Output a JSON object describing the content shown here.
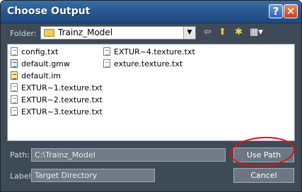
{
  "window": {
    "title": "Choose Output",
    "help_glyph": "?",
    "close_glyph": "✕"
  },
  "toolbar": {
    "folder_label": "Folder:",
    "folder_value": "Trainz_Model",
    "combo_arrow": "▼",
    "icons": {
      "back": "back-arrow-icon",
      "up": "up-folder-icon",
      "new_folder": "new-folder-icon",
      "views": "view-menu-icon"
    },
    "glyphs": {
      "back": "⇦",
      "up": "⬆",
      "new_folder": "✱",
      "views": "▦▾"
    }
  },
  "files": [
    {
      "name": "config.txt",
      "icon": "text-file-icon"
    },
    {
      "name": "default.gmw",
      "icon": "gmw-file-icon"
    },
    {
      "name": "default.im",
      "icon": "im-file-icon"
    },
    {
      "name": "EXTUR~1.texture.txt",
      "icon": "text-file-icon"
    },
    {
      "name": "EXTUR~2.texture.txt",
      "icon": "text-file-icon"
    },
    {
      "name": "EXTUR~3.texture.txt",
      "icon": "text-file-icon"
    },
    {
      "name": "EXTUR~4.texture.txt",
      "icon": "text-file-icon"
    },
    {
      "name": "exture.texture.txt",
      "icon": "text-file-icon"
    }
  ],
  "path": {
    "label": "Path:",
    "value": "C:\\Trainz_Model"
  },
  "label_field": {
    "label": "Label:",
    "value": "Target Directory"
  },
  "buttons": {
    "use_path": "Use Path",
    "cancel": "Cancel"
  },
  "colors": {
    "annotation": "#e01010",
    "titlebar": "#2a5a93",
    "dialog_bg": "#3f4a57"
  }
}
